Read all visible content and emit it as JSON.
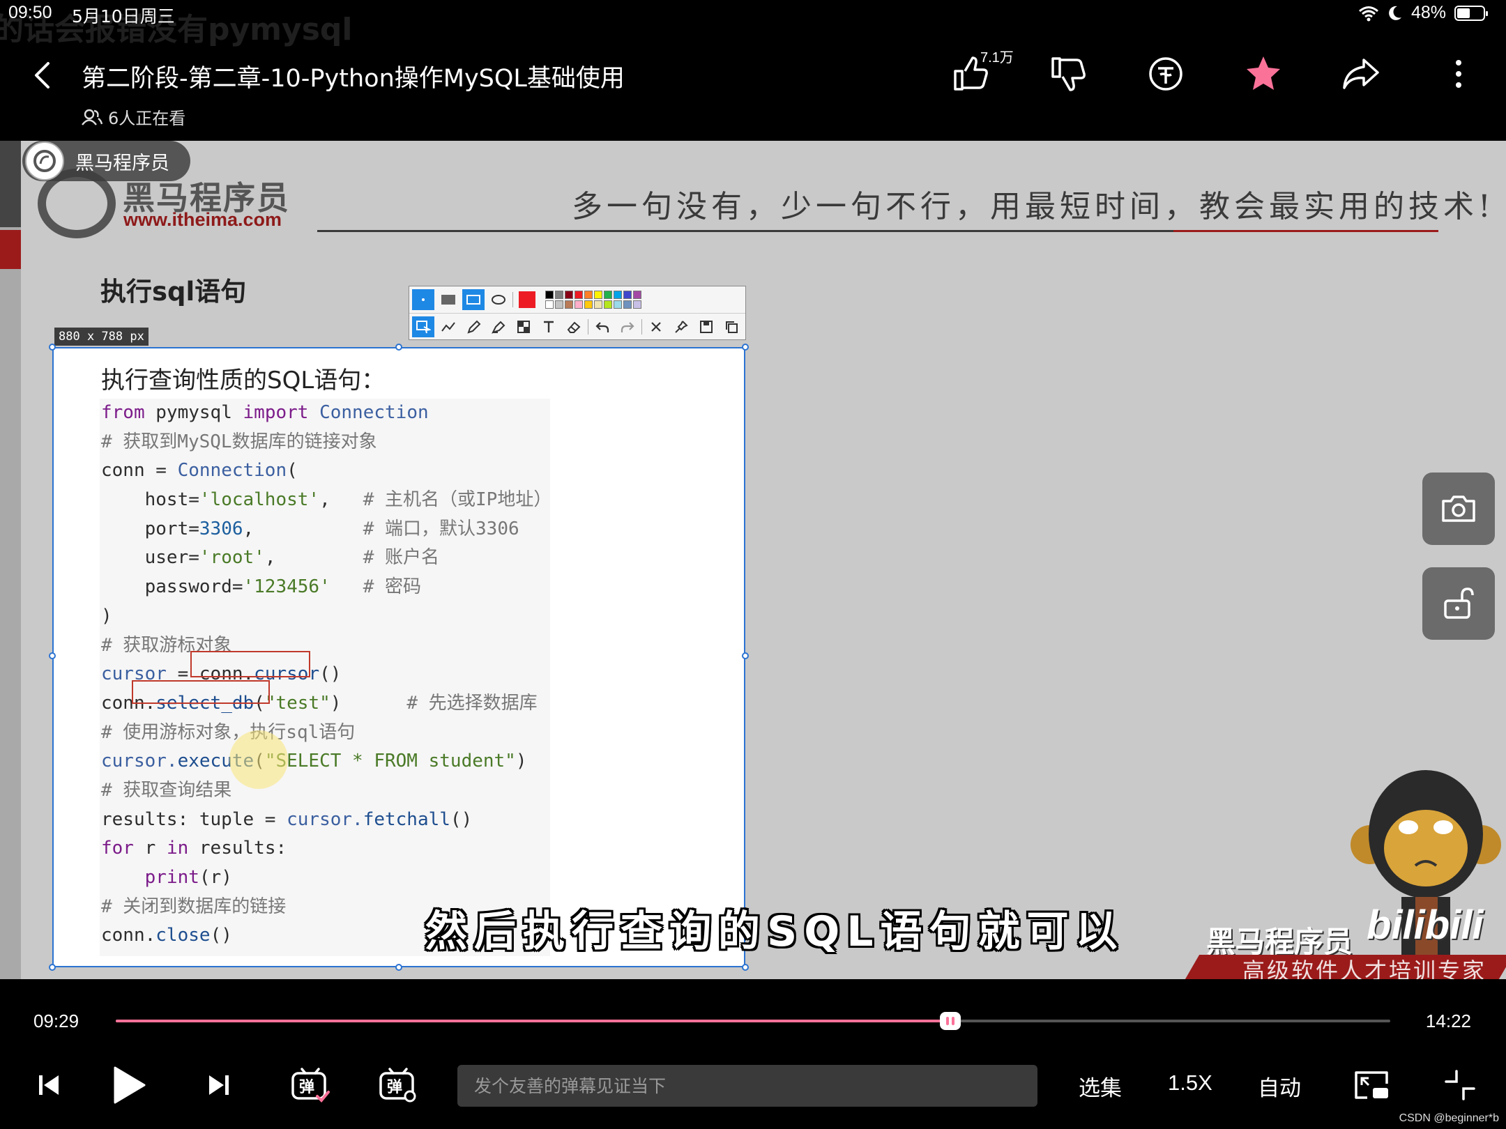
{
  "status_bar": {
    "time": "09:50",
    "date": "5月10日周三",
    "battery": "48%",
    "battery_level": 0.48,
    "behind_text": "的话会报错没有pymysql"
  },
  "header": {
    "title": "第二阶段-第二章-10-Python操作MySQL基础使用",
    "viewers": "6人正在看",
    "like_count": "7.1万",
    "icons": [
      "back-icon",
      "thumbs-up-icon",
      "thumbs-down-icon",
      "coin-icon",
      "star-icon",
      "share-icon",
      "more-icon"
    ],
    "favorite_color": "#fb7299"
  },
  "video": {
    "uploader_name": "黑马程序员",
    "logo_cn": "黑马程序员",
    "logo_url": "www.itheima.com",
    "slogan": "多一句没有，少一句不行，用最短时间，教会最实用的技术!",
    "slide_heading": "执行sql语句",
    "selection_size": "880 x 788  px",
    "code_title": "执行查询性质的SQL语句：",
    "code": {
      "l1a": "from",
      "l1b": " pymysql ",
      "l1c": "import",
      "l1d": " Connection",
      "l2": "# 获取到MySQL数据库的链接对象",
      "l3a": "conn = ",
      "l3b": "Connection",
      "l3c": "(",
      "l4a": "    host=",
      "l4b": "'localhost'",
      "l4c": ",   ",
      "l4d": "# 主机名（或IP地址）",
      "l5a": "    port=",
      "l5b": "3306",
      "l5c": ",          ",
      "l5d": "# 端口，默认3306",
      "l6a": "    user=",
      "l6b": "'root'",
      "l6c": ",        ",
      "l6d": "# 账户名",
      "l7a": "    password=",
      "l7b": "'123456'",
      "l7c": "   ",
      "l7d": "# 密码",
      "l8": ")",
      "l9": "# 获取游标对象",
      "l10a": "cursor",
      "l10b": " = ",
      "l10c": "conn.",
      "l10d": "cursor",
      "l10e": "()",
      "l11a": "conn.",
      "l11b": "select_db",
      "l11c": "(",
      "l11d": "\"test\"",
      "l11e": ")",
      "l11f": "      # 先选择数据库",
      "l12": "# 使用游标对象，执行sql语句",
      "l13a": "cursor.",
      "l13b": "execute",
      "l13c": "(",
      "l13d": "\"SELECT * FROM student\"",
      "l13e": ")",
      "l14": "# 获取查询结果",
      "l15a": "results: tuple = ",
      "l15b": "cursor.",
      "l15c": "fetchall",
      "l15d": "()",
      "l16a": "for",
      "l16b": " r ",
      "l16c": "in",
      "l16d": " results:",
      "l17a": "    ",
      "l17b": "print",
      "l17c": "(r)",
      "l18": "# 关闭到数据库的链接",
      "l19a": "conn.",
      "l19b": "close",
      "l19c": "()"
    },
    "subtitle": "然后执行查询的SQL语句就可以",
    "brand_cn": "黑马程序员",
    "brand_bili": "bilibili",
    "brand_sub": "高级软件人才培训专家"
  },
  "toolbar": {
    "palette": [
      "#000000",
      "#7f7f7f",
      "#880015",
      "#ed1c24",
      "#ff7f27",
      "#fff200",
      "#22b14c",
      "#00a2e8",
      "#3f48cc",
      "#a349a4",
      "#ffffff",
      "#c3c3c3",
      "#b97a57",
      "#ffaec9",
      "#ffc90e",
      "#efe4b0",
      "#b5e61d",
      "#99d9ea",
      "#7092be",
      "#c8bfe7"
    ],
    "current_color": "#ed1c24"
  },
  "player": {
    "current_time": "09:29",
    "total_time": "14:22",
    "progress": 0.655,
    "danmaku_placeholder": "发个友善的弹幕见证当下",
    "episodes_label": "选集",
    "speed_label": "1.5X",
    "quality_label": "自动",
    "accent_color": "#fb7299"
  },
  "watermark": "CSDN @beginner*b"
}
